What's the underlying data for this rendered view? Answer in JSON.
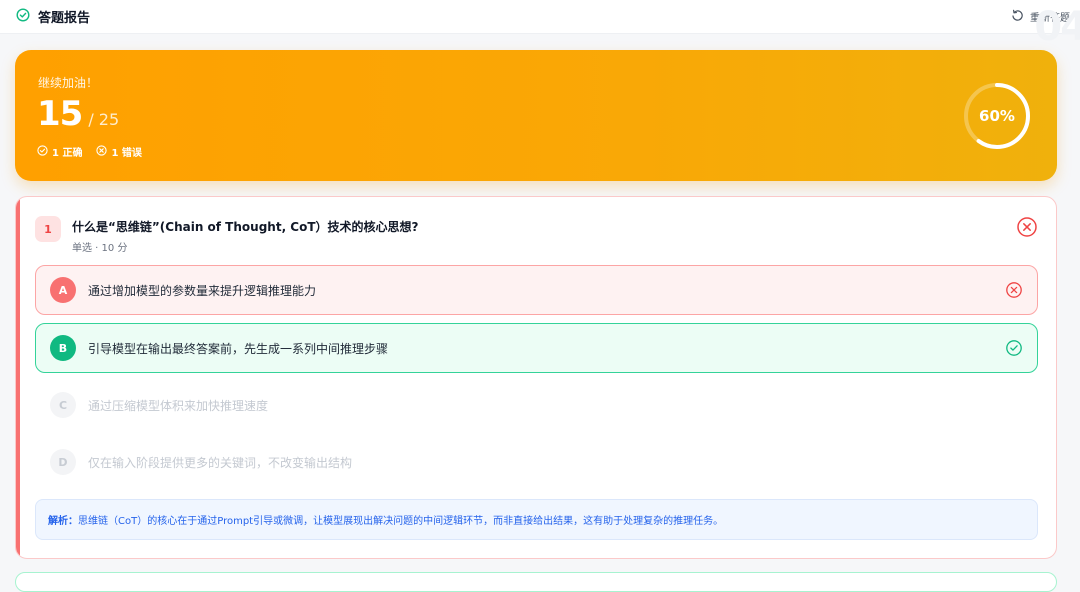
{
  "header": {
    "title": "答题报告",
    "retry_label": "重新答题",
    "watermark": "04"
  },
  "score": {
    "encourage": "继续加油！",
    "value": "15",
    "total": "/ 25",
    "correct_text": "1 正确",
    "wrong_text": "1 错误",
    "percent": 60,
    "percent_label": "60%"
  },
  "question": {
    "number": "1",
    "text": "什么是“思维链”(Chain of Thought, CoT）技术的核心思想?",
    "meta": "单选 · 10 分",
    "status": "wrong",
    "options": [
      {
        "letter": "A",
        "text": "通过增加模型的参数量来提升逻辑推理能力",
        "state": "wrong"
      },
      {
        "letter": "B",
        "text": "引导模型在输出最终答案前，先生成一系列中间推理步骤",
        "state": "correct"
      },
      {
        "letter": "C",
        "text": "通过压缩模型体积来加快推理速度",
        "state": "neutral"
      },
      {
        "letter": "D",
        "text": "仅在输入阶段提供更多的关键词，不改变输出结构",
        "state": "neutral"
      }
    ],
    "analysis_label": "解析：",
    "analysis_text": "思维链（CoT）的核心在于通过Prompt引导或微调，让模型展现出解决问题的中间逻辑环节，而非直接给出结果，这有助于处理复杂的推理任务。"
  },
  "colors": {
    "accent_orange": "#ffa000",
    "wrong_red": "#ef4444",
    "correct_green": "#10b981",
    "analysis_blue": "#2563eb"
  }
}
